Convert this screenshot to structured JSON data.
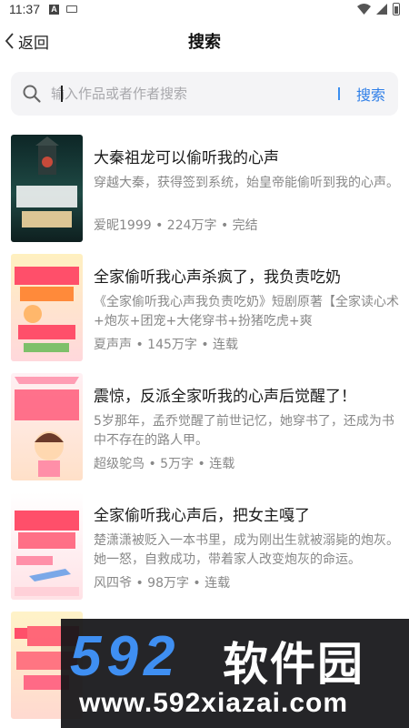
{
  "status_bar": {
    "time": "11:37",
    "notif_icon": "A"
  },
  "header": {
    "back_label": "返回",
    "title": "搜索"
  },
  "search": {
    "placeholder": "输入作品或者作者搜索",
    "button_label": "搜索"
  },
  "books": [
    {
      "title": "大秦祖龙可以偷听我的心声",
      "desc": "穿越大秦，获得签到系统，始皇帝能偷听到我的心声。",
      "meta": "爱昵1999 • 224万字 • 完结",
      "cover_colors": [
        "#0f2a2a",
        "#1f4a45"
      ],
      "cover_text": "可以偷听我的心声"
    },
    {
      "title": "全家偷听我心声杀疯了，我负责吃奶",
      "desc": "《全家偷听我心声我负责吃奶》短剧原著【全家读心术+炮灰+团宠+大佬穿书+扮猪吃虎+爽",
      "meta": "夏声声 • 145万字 • 连载",
      "cover_colors": [
        "#ffe7a8",
        "#ffd0d8"
      ],
      "cover_text": "全家偷听我心声"
    },
    {
      "title": "震惊，反派全家听我的心声后觉醒了！",
      "desc": "5岁那年，孟乔觉醒了前世记忆，她穿书了，还成为书中不存在的路人甲。",
      "meta": "超级鸵鸟 • 5万字 • 连载",
      "cover_colors": [
        "#ffe8f0",
        "#ffd6c0"
      ],
      "cover_text": "反派全家听我心声后觉醒了"
    },
    {
      "title": "全家偷听我心声后，把女主嘎了",
      "desc": "楚潇潇被贬入一本书里，成为刚出生就被溺毙的炮灰。她一怒，自救成功，带着家人改变炮灰的命运。",
      "meta": "风四爷 • 98万字 • 连载",
      "cover_colors": [
        "#ffffff",
        "#ffe2e6"
      ],
      "cover_text": "全家偷听我心声后"
    },
    {
      "title": "",
      "desc": "",
      "meta": "",
      "cover_colors": [
        "#fff3c8",
        "#ffd9d0"
      ],
      "cover_text": "被偷听"
    }
  ],
  "watermark": {
    "logo_num": "592",
    "logo_cn": "软件园",
    "url": "www.592xiazai.com"
  }
}
